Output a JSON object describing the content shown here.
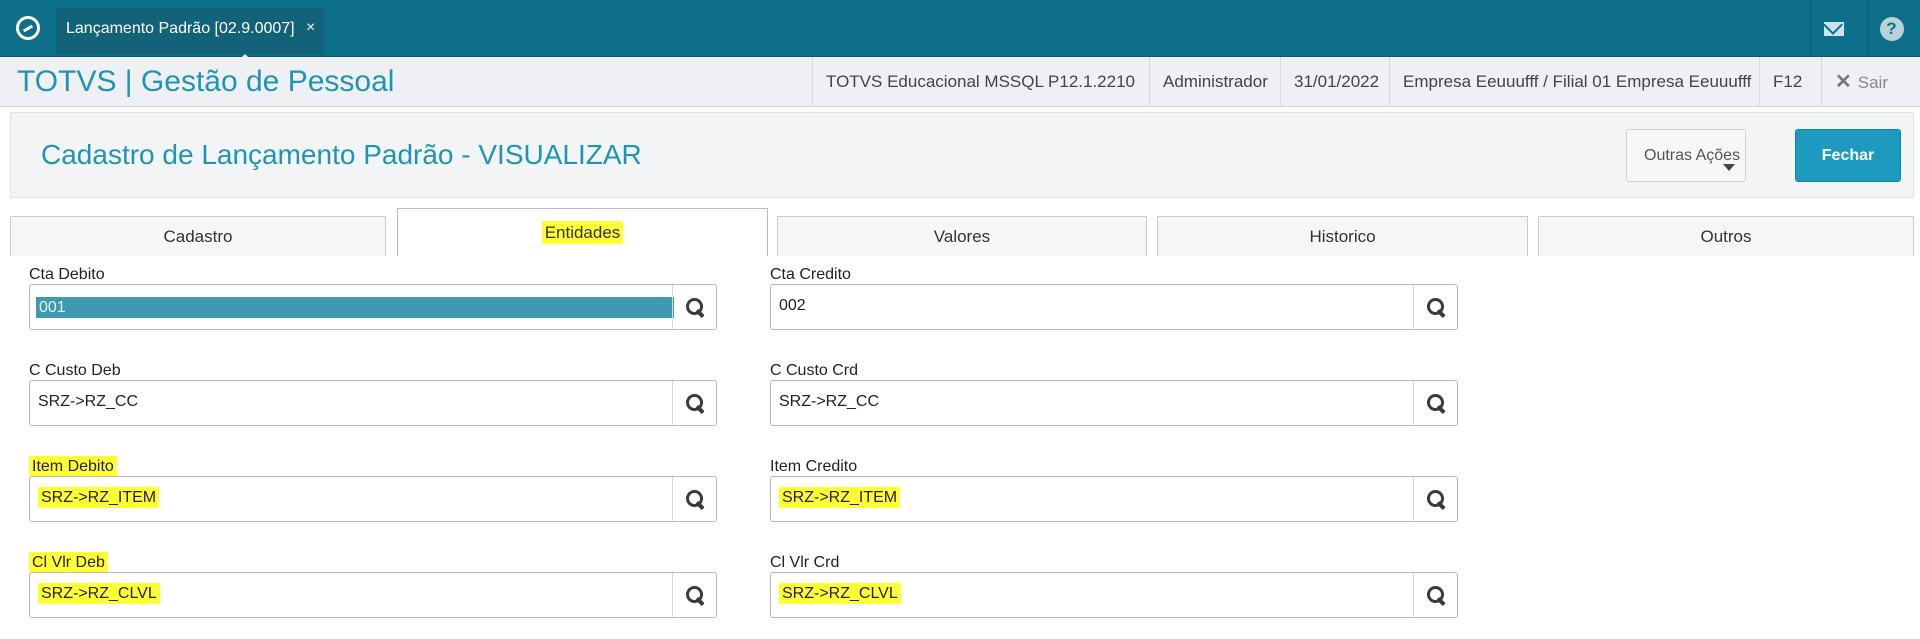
{
  "window": {
    "tab_title": "Lançamento Padrão [02.9.0007]",
    "close_glyph": "×"
  },
  "header": {
    "brand": "TOTVS | Gestão de Pessoal",
    "environment": "TOTVS Educacional MSSQL P12.1.2210",
    "user": "Administrador",
    "date": "31/01/2022",
    "company": "Empresa Eeuuufff / Filial 01 Empresa Eeuuufff",
    "shortcut": "F12",
    "exit_label": "Sair",
    "exit_glyph": "✕"
  },
  "toolbar": {
    "page_title": "Cadastro de Lançamento Padrão - VISUALIZAR",
    "other_actions_label": "Outras Ações",
    "close_label": "Fechar"
  },
  "tabs": [
    "Cadastro",
    "Entidades",
    "Valores",
    "Historico",
    "Outros"
  ],
  "active_tab": "Entidades",
  "form": {
    "cta_debito": {
      "label": "Cta Debito",
      "value": "001"
    },
    "cta_credito": {
      "label": "Cta Credito",
      "value": "002"
    },
    "c_custo_deb": {
      "label": "C Custo Deb",
      "value": "SRZ->RZ_CC"
    },
    "c_custo_crd": {
      "label": "C Custo Crd",
      "value": "SRZ->RZ_CC"
    },
    "item_debito": {
      "label": "Item Debito",
      "value": "SRZ->RZ_ITEM"
    },
    "item_credito": {
      "label": "Item Credito",
      "value": "SRZ->RZ_ITEM"
    },
    "cl_vlr_deb": {
      "label": "Cl Vlr Deb",
      "value": "SRZ->RZ_CLVL"
    },
    "cl_vlr_crd": {
      "label": "Cl Vlr Crd",
      "value": "SRZ->RZ_CLVL"
    }
  },
  "icons": {
    "lookup": "search-icon",
    "mail": "mail-icon",
    "help": "help-icon",
    "logo": "totvs-logo-icon"
  },
  "colors": {
    "topbar": "#0e6f8a",
    "accent": "#1f95b6",
    "primary_button": "#1e9ac0",
    "selection": "#3e9ab0",
    "highlight": "#ffff33"
  }
}
